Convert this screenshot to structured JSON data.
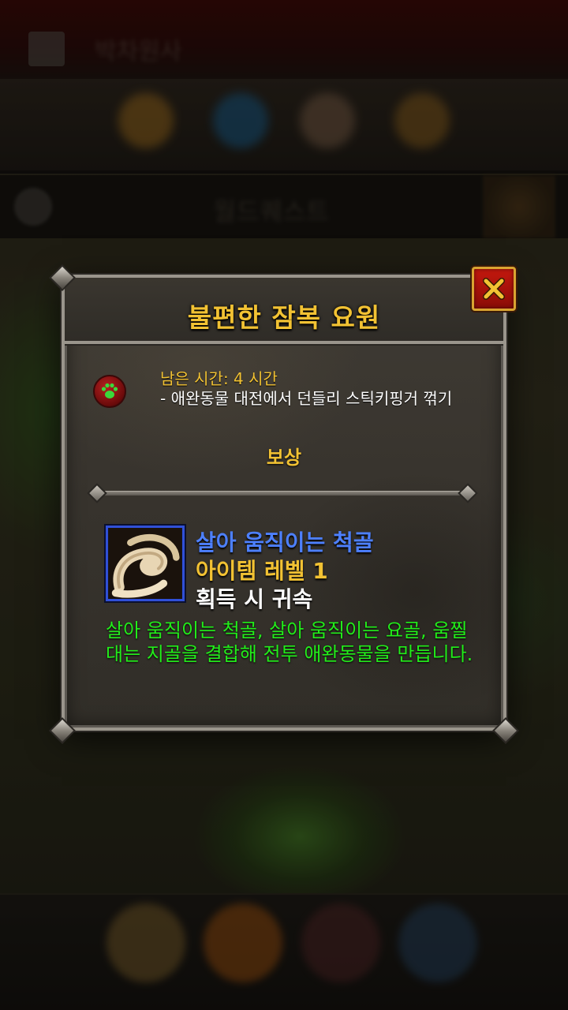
{
  "background": {
    "app_title": "박차원사",
    "search_text": "월드퀘스트"
  },
  "dialog": {
    "title": "불편한 잠복 요원",
    "close_label": "✕",
    "quest_icon": "paw-icon",
    "time_left": "남은 시간: 4 시간",
    "objective": "- 애완동물 대전에서 던들리 스틱키핑거 꺾기",
    "rewards_heading": "보상",
    "reward": {
      "icon": "bone-spine-icon",
      "name": "살아 움직이는 척골",
      "item_level": "아이템 레벨 1",
      "binding": "획득 시 귀속",
      "description": "살아 움직이는 척골, 살아 움직이는 요골, 움찔대는 지골을 결합해 전투 애완동물을 만듭니다."
    }
  },
  "colors": {
    "title_gold": "#f2c233",
    "item_name_blue": "#4d80ff",
    "description_green": "#22ee1a",
    "close_red": "#c4180e"
  }
}
